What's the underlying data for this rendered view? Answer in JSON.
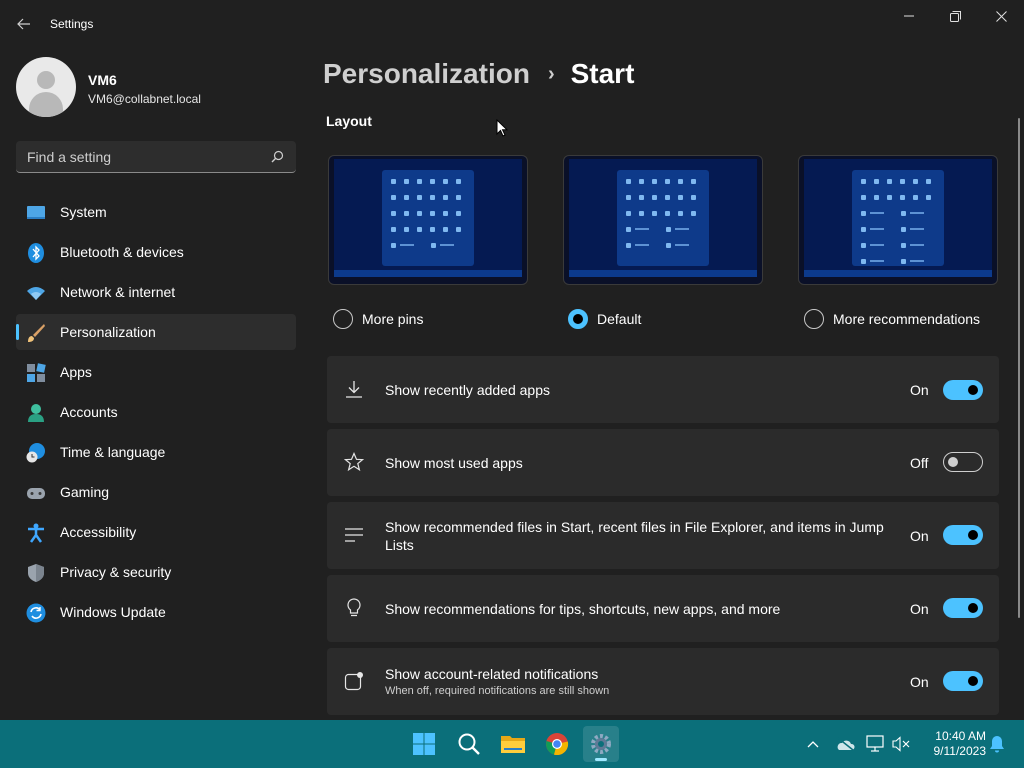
{
  "window": {
    "title": "Settings"
  },
  "profile": {
    "name": "VM6",
    "email": "VM6@collabnet.local"
  },
  "search": {
    "placeholder": "Find a setting"
  },
  "sidebar": {
    "items": [
      {
        "label": "System",
        "icon": "system-icon",
        "active": false
      },
      {
        "label": "Bluetooth & devices",
        "icon": "bluetooth-icon",
        "active": false
      },
      {
        "label": "Network & internet",
        "icon": "wifi-icon",
        "active": false
      },
      {
        "label": "Personalization",
        "icon": "brush-icon",
        "active": true
      },
      {
        "label": "Apps",
        "icon": "apps-icon",
        "active": false
      },
      {
        "label": "Accounts",
        "icon": "accounts-icon",
        "active": false
      },
      {
        "label": "Time & language",
        "icon": "globe-clock-icon",
        "active": false
      },
      {
        "label": "Gaming",
        "icon": "gamepad-icon",
        "active": false
      },
      {
        "label": "Accessibility",
        "icon": "accessibility-icon",
        "active": false
      },
      {
        "label": "Privacy & security",
        "icon": "shield-icon",
        "active": false
      },
      {
        "label": "Windows Update",
        "icon": "update-icon",
        "active": false
      }
    ]
  },
  "breadcrumb": {
    "parent": "Personalization",
    "separator": "›",
    "current": "Start"
  },
  "layout": {
    "title": "Layout",
    "options": [
      {
        "label": "More pins",
        "checked": false
      },
      {
        "label": "Default",
        "checked": true
      },
      {
        "label": "More recommendations",
        "checked": false
      }
    ]
  },
  "settings": [
    {
      "label": "Show recently added apps",
      "state": "On",
      "on": true,
      "icon": "download-icon"
    },
    {
      "label": "Show most used apps",
      "state": "Off",
      "on": false,
      "icon": "star-icon"
    },
    {
      "label": "Show recommended files in Start, recent files in File Explorer, and items in Jump Lists",
      "state": "On",
      "on": true,
      "icon": "list-icon"
    },
    {
      "label": "Show recommendations for tips, shortcuts, new apps, and more",
      "state": "On",
      "on": true,
      "icon": "lightbulb-icon"
    },
    {
      "label": "Show account-related notifications",
      "sublabel": "When off, required notifications are still shown",
      "state": "On",
      "on": true,
      "icon": "notification-badge-icon"
    }
  ],
  "taskbar": {
    "apps": [
      "start-icon",
      "search-icon",
      "file-explorer-icon",
      "chrome-icon",
      "settings-icon"
    ],
    "time": "10:40 AM",
    "date": "9/11/2023"
  },
  "colors": {
    "accent": "#4cc2ff",
    "background": "#202020",
    "card": "#2b2b2b",
    "taskbar": "#0b6f7a"
  }
}
